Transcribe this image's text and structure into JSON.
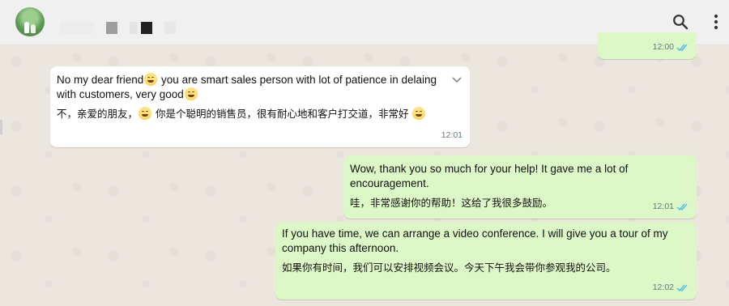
{
  "header": {
    "contact_name_redacted": true,
    "icons": [
      "search-icon",
      "more-vert-icon"
    ]
  },
  "messages": [
    {
      "direction": "out",
      "text_en": "",
      "text_zh": "",
      "time": "12:00",
      "status": "read"
    },
    {
      "direction": "in",
      "text_en_parts": [
        "No my dear friend",
        " you are smart sales person with lot of patience in delaing with customers, very good"
      ],
      "text_zh_parts": [
        "不，亲爱的朋友，",
        " 你是个聪明的销售员，很有耐心地和客户打交道，非常好 "
      ],
      "emoji": "grinning-face",
      "time": "12:01"
    },
    {
      "direction": "out",
      "text_en": "Wow, thank you so much for your help! It gave me a lot of encouragement.",
      "text_zh": "哇，非常感谢你的帮助！这给了我很多鼓励。",
      "time": "12:01",
      "status": "read"
    },
    {
      "direction": "out",
      "text_en": "If you have time, we can arrange a video conference. I will give you a tour of my company this afternoon.",
      "text_zh": "如果你有时间，我们可以安排视频会议。今天下午我会带你参观我的公司。",
      "time": "12:02",
      "status": "read"
    }
  ],
  "colors": {
    "outgoing_bubble": "#dcf8c6",
    "incoming_bubble": "#ffffff",
    "read_ticks": "#53bdeb",
    "header_bg": "#f0f0f0"
  }
}
